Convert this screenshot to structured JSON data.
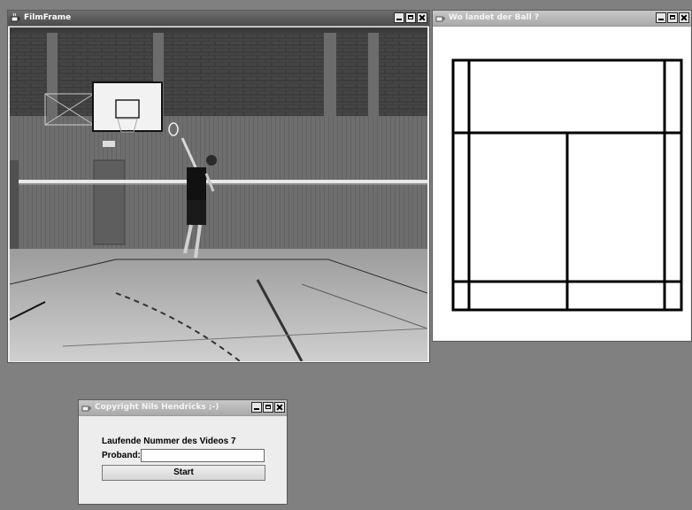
{
  "windows": {
    "film": {
      "title": "FilmFrame"
    },
    "court": {
      "title": "Wo landet der Ball ?"
    },
    "dialog": {
      "title": "Copyright Nils Hendricks ;-)",
      "video_number_label": "Laufende Nummer des Videos 7",
      "subject_label": "Proband:",
      "subject_value": "",
      "start_label": "Start"
    }
  },
  "icons": {
    "window_icon": "java-cup-icon",
    "minimize": "minimize-icon",
    "maximize": "maximize-icon",
    "close": "close-icon"
  },
  "colors": {
    "desktop": "#808080",
    "active_title": "#5a5a5a",
    "inactive_title": "#b8b8b8",
    "court_lines": "#000000"
  }
}
